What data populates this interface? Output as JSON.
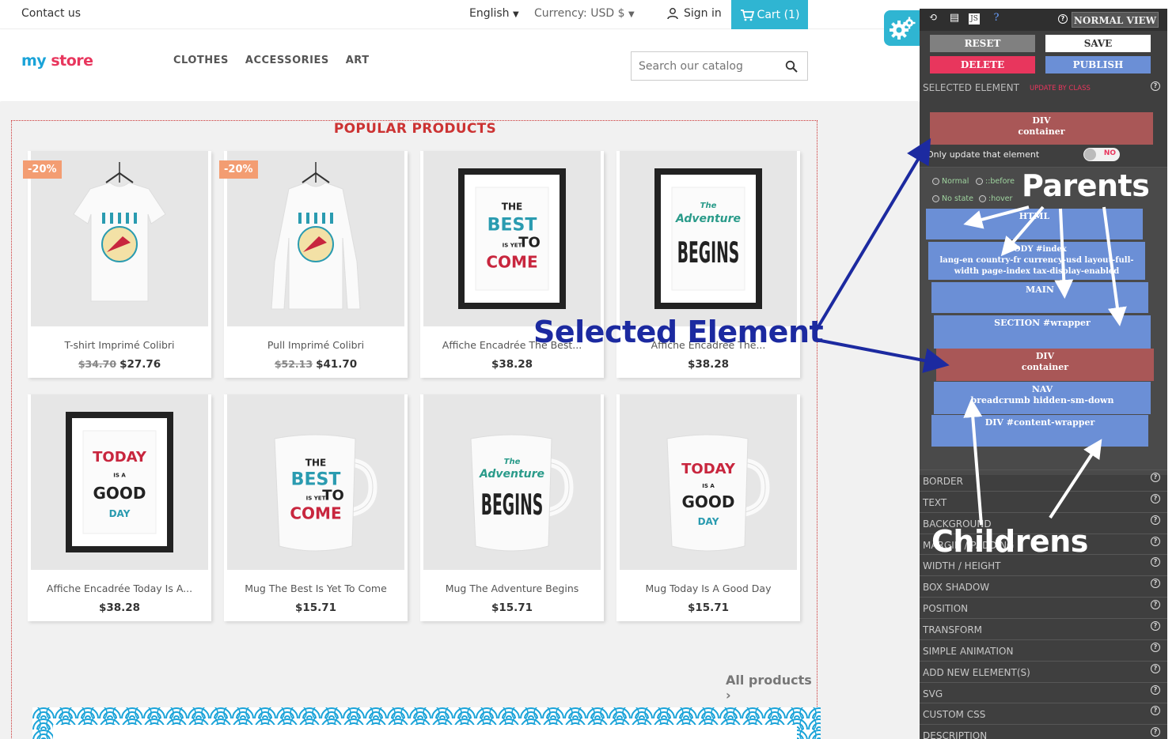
{
  "topbar": {
    "contact": "Contact us",
    "language": "English",
    "currency": "Currency: USD $",
    "signin": "Sign in",
    "cart": "Cart (1)"
  },
  "header": {
    "logo_part1": "my",
    "logo_part2": "store",
    "nav": [
      "CLOTHES",
      "ACCESSORIES",
      "ART"
    ],
    "search_placeholder": "Search our catalog"
  },
  "popular": {
    "title": "POPULAR PRODUCTS",
    "all_products": "All products",
    "products": [
      {
        "name": "T-shirt Imprimé Colibri",
        "old_price": "$34.70",
        "price": "$27.76",
        "badge": "-20%",
        "art": "tshirt"
      },
      {
        "name": "Pull Imprimé Colibri",
        "old_price": "$52.13",
        "price": "$41.70",
        "badge": "-20%",
        "art": "sweater"
      },
      {
        "name": "Affiche Encadrée The Best...",
        "old_price": "",
        "price": "$38.28",
        "badge": "",
        "art": "frame-best"
      },
      {
        "name": "Affiche Encadrée The...",
        "old_price": "",
        "price": "$38.28",
        "badge": "",
        "art": "frame-adventure"
      },
      {
        "name": "Affiche Encadrée Today Is A...",
        "old_price": "",
        "price": "$38.28",
        "badge": "",
        "art": "frame-today"
      },
      {
        "name": "Mug The Best Is Yet To Come",
        "old_price": "",
        "price": "$15.71",
        "badge": "",
        "art": "mug-best"
      },
      {
        "name": "Mug The Adventure Begins",
        "old_price": "",
        "price": "$15.71",
        "badge": "",
        "art": "mug-adventure"
      },
      {
        "name": "Mug Today Is A Good Day",
        "old_price": "",
        "price": "$15.71",
        "badge": "",
        "art": "mug-today"
      }
    ]
  },
  "artwork_text": {
    "best": [
      "THE",
      "BEST",
      "IS YET",
      "TO",
      "COME"
    ],
    "adventure": [
      "The",
      "Adventure",
      "BEGINS"
    ],
    "today": [
      "TODAY",
      "IS A",
      "GOOD",
      "DAY"
    ]
  },
  "editor": {
    "reset": "RESET",
    "save": "SAVE",
    "delete": "DELETE",
    "publish": "PUBLISH",
    "normal_view": "NORMAL VIEW",
    "selected_label": "SELECTED ELEMENT",
    "update_by_class": "UPDATE BY CLASS",
    "selected_tag": "DIV",
    "selected_class": "container",
    "only_update": "Only update that element",
    "toggle_state": "NO",
    "states": [
      "Normal",
      "::before",
      "No state",
      ":hover"
    ],
    "tree": [
      {
        "tag": "HTML",
        "cls": ""
      },
      {
        "tag": "BODY #index",
        "cls": "lang-en country-fr currency-usd layout-full-width page-index tax-display-enabled"
      },
      {
        "tag": "MAIN",
        "cls": ""
      },
      {
        "tag": "SECTION #wrapper",
        "cls": ""
      },
      {
        "tag": "DIV",
        "cls": "container"
      },
      {
        "tag": "NAV",
        "cls": "breadcrumb hidden-sm-down"
      },
      {
        "tag": "DIV #content-wrapper",
        "cls": ""
      }
    ],
    "sections": [
      "BORDER",
      "TEXT",
      "BACKGROUND",
      "MARGIN / PADDING",
      "WIDTH / HEIGHT",
      "BOX SHADOW",
      "POSITION",
      "TRANSFORM",
      "SIMPLE ANIMATION",
      "ADD NEW ELEMENT(S)",
      "SVG",
      "CUSTOM CSS",
      "DESCRIPTION"
    ]
  },
  "annotations": {
    "selected": "Selected Element",
    "parents": "Parents",
    "children": "Childrens"
  },
  "colors": {
    "accent": "#2fb5d2",
    "danger": "#e8365d",
    "publish": "#6b8fd6",
    "selected_node": "#a95757",
    "annotation_blue": "#1c2aa0"
  }
}
